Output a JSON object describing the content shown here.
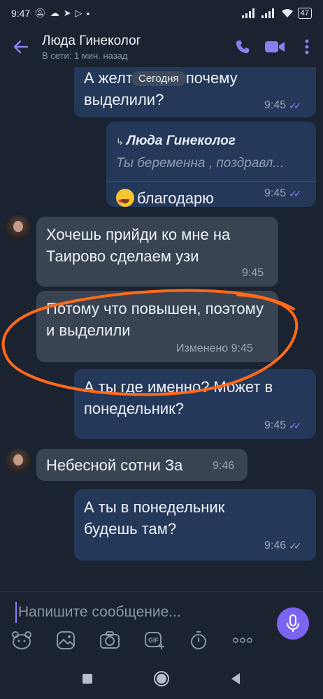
{
  "status_bar": {
    "time": "9:47",
    "battery": "47"
  },
  "header": {
    "contact_name": "Люда Гинеколог",
    "contact_status": "В сети: 1 мин. назад"
  },
  "chat": {
    "date_label": "Сегодня",
    "messages": [
      {
        "dir": "out",
        "text": "А желтым это почему выделили?",
        "time": "9:45"
      },
      {
        "dir": "out",
        "reply_to": "Люда Гинеколог",
        "reply_text": "Ты беременна , поздравл...",
        "text": "благодарю",
        "time": "9:45"
      },
      {
        "dir": "in",
        "text": "Хочешь прийди ко мне на Таирово сделаем узи",
        "time": "9:45"
      },
      {
        "dir": "in",
        "text": "Потому что повышен, поэтому и выделили",
        "time": "9:45",
        "edited_label": "Изменено"
      },
      {
        "dir": "out",
        "text": "А ты где именно? Может в понедельник?",
        "time": "9:45"
      },
      {
        "dir": "in",
        "text": "Небесной сотни За",
        "time": "9:46"
      },
      {
        "dir": "out",
        "text": "А ты в понедельник будешь там?",
        "time": "9:46"
      }
    ]
  },
  "composer": {
    "placeholder": "Напишите сообщение..."
  },
  "colors": {
    "accent": "#7b64f0",
    "outgoing": "#24385a",
    "incoming": "#3a4352",
    "annotation": "#ff6a1a"
  }
}
